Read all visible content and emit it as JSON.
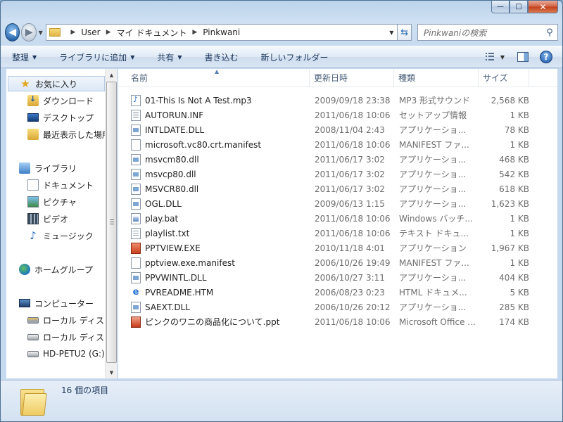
{
  "window": {
    "buttons": {
      "minimize": "—",
      "maximize": "□",
      "close": "✕"
    }
  },
  "address": {
    "back_glyph": "◀",
    "forward_glyph": "▶",
    "history_dropdown": "▼",
    "crumbs": [
      "User",
      "マイ ドキュメント",
      "Pinkwani"
    ],
    "crumb_separator": "▶",
    "dropdown_glyph": "▼",
    "refresh_glyph": "⇆"
  },
  "search": {
    "placeholder": "Pinkwaniの検索",
    "icon": "search-icon"
  },
  "toolbar": {
    "items": [
      "整理",
      "ライブラリに追加",
      "共有",
      "書き込む",
      "新しいフォルダー"
    ],
    "has_dropdown": [
      true,
      true,
      true,
      false,
      false
    ],
    "view_dropdown": "▼",
    "help_label": "?"
  },
  "nav_pane": {
    "favorites": {
      "label": "お気に入り",
      "items": [
        "ダウンロード",
        "デスクトップ",
        "最近表示した場所"
      ]
    },
    "libraries": {
      "label": "ライブラリ",
      "items": [
        "ドキュメント",
        "ピクチャ",
        "ビデオ",
        "ミュージック"
      ]
    },
    "homegroup": {
      "label": "ホームグループ"
    },
    "computer": {
      "label": "コンピューター",
      "items": [
        "ローカル ディスク",
        "ローカル ディスク",
        "HD-PETU2 (G:)"
      ]
    }
  },
  "columns": {
    "name": "名前",
    "date": "更新日時",
    "type": "種類",
    "size": "サイズ"
  },
  "files": [
    {
      "name": "01-This Is Not A Test.mp3",
      "date": "2009/09/18 23:38",
      "type": "MP3 形式サウンド",
      "size": "2,568 KB",
      "icon": "mp3"
    },
    {
      "name": "AUTORUN.INF",
      "date": "2011/06/18 10:06",
      "type": "セットアップ情報",
      "size": "1 KB",
      "icon": "inf"
    },
    {
      "name": "INTLDATE.DLL",
      "date": "2008/11/04 2:43",
      "type": "アプリケーショ...",
      "size": "78 KB",
      "icon": "dll"
    },
    {
      "name": "microsoft.vc80.crt.manifest",
      "date": "2011/06/18 10:06",
      "type": "MANIFEST ファ...",
      "size": "1 KB",
      "icon": "blank"
    },
    {
      "name": "msvcm80.dll",
      "date": "2011/06/17 3:02",
      "type": "アプリケーショ...",
      "size": "468 KB",
      "icon": "dll"
    },
    {
      "name": "msvcp80.dll",
      "date": "2011/06/17 3:02",
      "type": "アプリケーショ...",
      "size": "542 KB",
      "icon": "dll"
    },
    {
      "name": "MSVCR80.dll",
      "date": "2011/06/17 3:02",
      "type": "アプリケーショ...",
      "size": "618 KB",
      "icon": "dll"
    },
    {
      "name": "OGL.DLL",
      "date": "2009/06/13 1:15",
      "type": "アプリケーショ...",
      "size": "1,623 KB",
      "icon": "dll"
    },
    {
      "name": "play.bat",
      "date": "2011/06/18 10:06",
      "type": "Windows バッチ...",
      "size": "1 KB",
      "icon": "bat"
    },
    {
      "name": "playlist.txt",
      "date": "2011/06/18 10:06",
      "type": "テキスト ドキュ...",
      "size": "1 KB",
      "icon": "txt"
    },
    {
      "name": "PPTVIEW.EXE",
      "date": "2010/11/18 4:01",
      "type": "アプリケーション",
      "size": "1,967 KB",
      "icon": "exe"
    },
    {
      "name": "pptview.exe.manifest",
      "date": "2006/10/26 19:49",
      "type": "MANIFEST ファ...",
      "size": "1 KB",
      "icon": "blank"
    },
    {
      "name": "PPVWINTL.DLL",
      "date": "2006/10/27 3:11",
      "type": "アプリケーショ...",
      "size": "404 KB",
      "icon": "dll"
    },
    {
      "name": "PVREADME.HTM",
      "date": "2006/08/23 0:23",
      "type": "HTML ドキュメ...",
      "size": "5 KB",
      "icon": "htm"
    },
    {
      "name": "SAEXT.DLL",
      "date": "2006/10/26 20:12",
      "type": "アプリケーショ...",
      "size": "285 KB",
      "icon": "dll"
    },
    {
      "name": "ピンクのワニの商品化について.ppt",
      "date": "2011/06/18 10:06",
      "type": "Microsoft Office ...",
      "size": "174 KB",
      "icon": "ppt"
    }
  ],
  "status": {
    "text": "16 個の項目"
  }
}
